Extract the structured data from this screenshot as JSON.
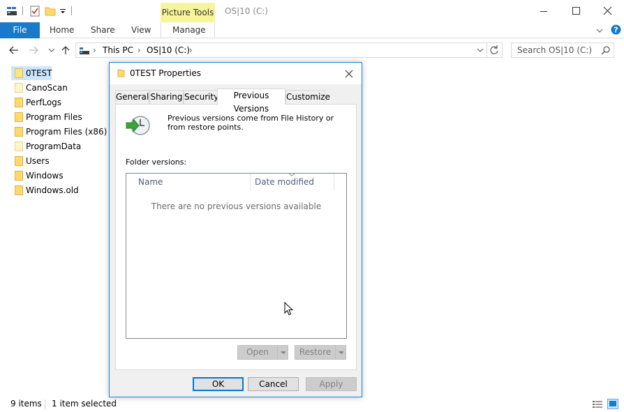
{
  "window": {
    "title": "OS|10 (C:)",
    "contextual_tab_group": "Picture Tools"
  },
  "ribbon": {
    "tabs": [
      {
        "label": "File"
      },
      {
        "label": "Home"
      },
      {
        "label": "Share"
      },
      {
        "label": "View"
      },
      {
        "label": "Manage"
      }
    ]
  },
  "address": {
    "breadcrumbs": [
      "This PC",
      "OS|10 (C:)"
    ],
    "search_placeholder": "Search OS|10 (C:)"
  },
  "nav_pane": {
    "items": [
      {
        "label": "0TEST",
        "selected": true
      },
      {
        "label": "CanoScan"
      },
      {
        "label": "PerfLogs"
      },
      {
        "label": "Program Files"
      },
      {
        "label": "Program Files (x86)"
      },
      {
        "label": "ProgramData"
      },
      {
        "label": "Users"
      },
      {
        "label": "Windows"
      },
      {
        "label": "Windows.old"
      }
    ]
  },
  "status": {
    "item_count": "9 items",
    "selected": "1 item selected"
  },
  "dialog": {
    "title": "0TEST Properties",
    "tabs": [
      {
        "label": "General"
      },
      {
        "label": "Sharing"
      },
      {
        "label": "Security"
      },
      {
        "label": "Previous Versions",
        "active": true
      },
      {
        "label": "Customize"
      }
    ],
    "description": "Previous versions come from File History or from restore points.",
    "folder_versions_label": "Folder versions:",
    "columns": [
      "Name",
      "Date modified"
    ],
    "empty_message": "There are no previous versions available",
    "open_label": "Open",
    "restore_label": "Restore",
    "ok_label": "OK",
    "cancel_label": "Cancel",
    "apply_label": "Apply"
  },
  "colors": {
    "file_tab": "#1979ca",
    "contextual_tab": "#f7f59a",
    "selection": "#cce8ff",
    "dialog_border": "#1883d7"
  }
}
